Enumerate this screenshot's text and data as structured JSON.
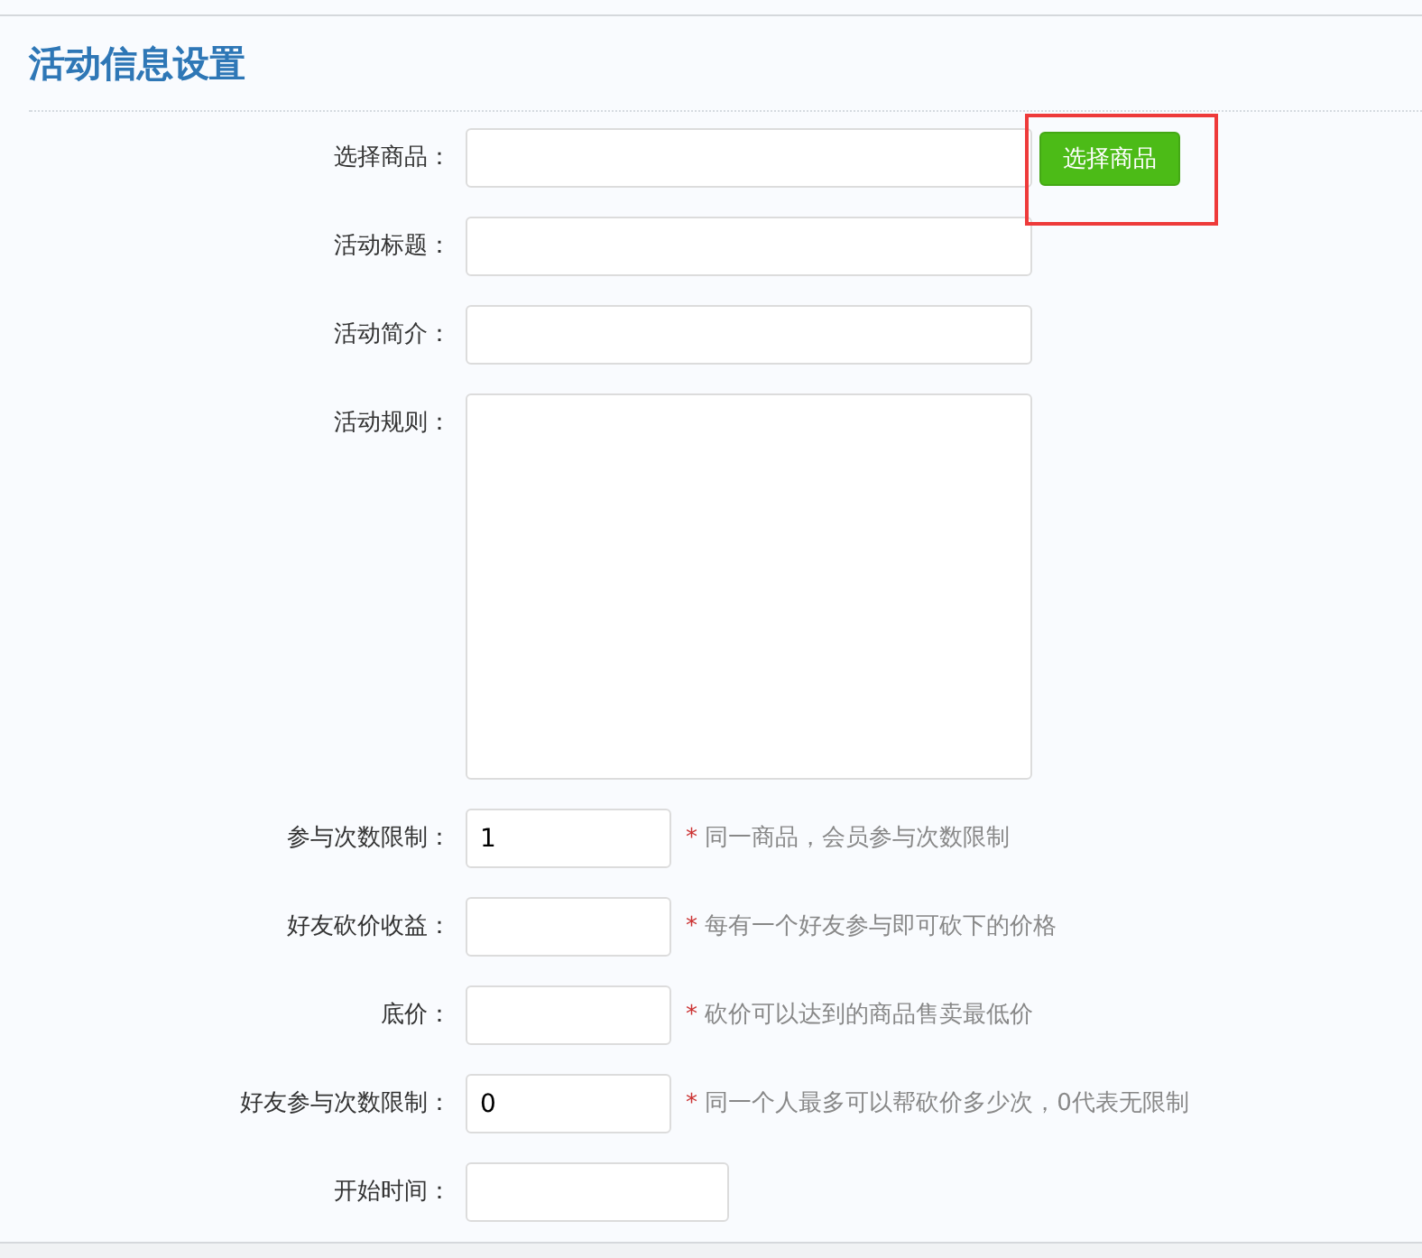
{
  "section": {
    "title": "活动信息设置"
  },
  "fields": [
    {
      "label": "选择商品：",
      "kind": "wide",
      "button": {
        "label": "选择商品",
        "highlighted": true
      }
    },
    {
      "label": "活动标题：",
      "kind": "wide"
    },
    {
      "label": "活动简介：",
      "kind": "wide"
    },
    {
      "label": "活动规则：",
      "kind": "textarea"
    },
    {
      "label": "参与次数限制：",
      "kind": "short",
      "value": "1",
      "mark": "*",
      "hint": "同一商品，会员参与次数限制"
    },
    {
      "label": "好友砍价收益：",
      "kind": "short",
      "mark": "*",
      "hint": "每有一个好友参与即可砍下的价格"
    },
    {
      "label": "底价：",
      "kind": "short",
      "mark": "*",
      "hint": "砍价可以达到的商品售卖最低价"
    },
    {
      "label": "好友参与次数限制：",
      "kind": "short",
      "value": "0",
      "mark": "*",
      "hint": "同一个人最多可以帮砍价多少次，0代表无限制"
    },
    {
      "label": "开始时间：",
      "kind": "medium"
    }
  ]
}
